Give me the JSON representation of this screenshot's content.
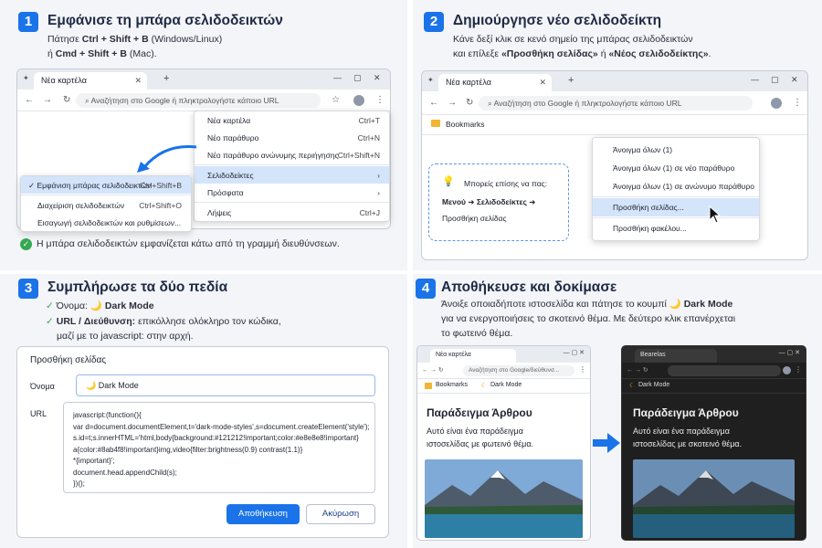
{
  "step1": {
    "num": "1",
    "title": "Εμφάνισε τη μπάρα σελιδοδεικτών",
    "line1_pre": "Πάτησε ",
    "line1_keys": "Ctrl + Shift + B",
    "line1_post": " (Windows/Linux)",
    "line2_pre": "ή ",
    "line2_keys": "Cmd + Shift + B",
    "line2_post": " (Mac).",
    "tab": "Νέα καρτέλα",
    "address": "Αναζήτηση στο Google ή πληκτρολογήστε κάποιο URL",
    "menu": [
      {
        "label": "Νέα καρτέλα",
        "sc": "Ctrl+T"
      },
      {
        "label": "Νέο παράθυρο",
        "sc": "Ctrl+N"
      },
      {
        "label": "Νέο παράθυρο ανώνυμης περιήγησης",
        "sc": "Ctrl+Shift+N"
      },
      {
        "label": "Σελιδοδείκτες",
        "sc": "›"
      },
      {
        "label": "Πρόσφατα",
        "sc": "›"
      },
      {
        "label": "Λήψεις",
        "sc": "Ctrl+J"
      }
    ],
    "submenu": [
      {
        "label": "✓  Εμφάνιση μπάρας σελιδοδεικτών",
        "sc": "Ctrl+Shift+B"
      },
      {
        "label": "Διαχείριση σελιδοδεικτών",
        "sc": "Ctrl+Shift+O"
      },
      {
        "label": "Εισαγωγή σελιδοδεικτών και ρυθμίσεων...",
        "sc": ""
      }
    ],
    "result": "Η μπάρα σελιδοδεικτών εμφανίζεται κάτω από τη γραμμή διευθύνσεων."
  },
  "step2": {
    "num": "2",
    "title": "Δημιούργησε νέο σελιδοδείκτη",
    "line1": "Κάνε δεξί κλικ σε κενό σημείο της μπάρας σελιδοδεικτών",
    "line2_pre": "και επίλεξε ",
    "line2_a": "«Προσθήκη σελίδας»",
    "line2_mid": " ή ",
    "line2_b": "«Νέος σελιδοδείκτης»",
    "line2_post": ".",
    "tab": "Νέα καρτέλα",
    "address": "Αναζήτηση στο Google ή πληκτρολογήστε κάποιο URL",
    "bookmarks": "Bookmarks",
    "tip_title": "Μπορείς επίσης να πας:",
    "tip_path": "Μενού  ➜  Σελιδοδείκτες  ➜",
    "tip_last": "Προσθήκη σελίδας",
    "menu": [
      "Άνοιγμα όλων (1)",
      "Άνοιγμα όλων (1) σε νέο παράθυρο",
      "Άνοιγμα όλων (1) σε ανώνυμο παράθυρο",
      "Προσθήκη σελίδας...",
      "Προσθήκη φακέλου..."
    ]
  },
  "step3": {
    "num": "3",
    "title": "Συμπλήρωσε τα δύο πεδία",
    "b1_label": "Όνομα:",
    "b1_value": "🌙 Dark Mode",
    "b2_label": "URL / Διεύθυνση:",
    "b2_text": " επικόλλησε ολόκληρο τον κώδικα,",
    "b3": "μαζί με το javascript: στην αρχή.",
    "form_title": "Προσθήκη σελίδας",
    "name_label": "Όνομα",
    "name_value": "🌙 Dark Mode",
    "url_label": "URL",
    "code": [
      "javascript:(function(){",
      "var d=document.documentElement,t='dark-mode-styles',s=document.createElement('style');",
      "s.id=t;s.innerHTML='html,body{background:#121212!important;color:#e8e8e8!important}",
      "a{color:#8ab4f8!important}img,video{filter:brightness(0.9) contrast(1.1)}",
      "*{important}';",
      "document.head.appendChild(s);",
      "})();"
    ],
    "save": "Αποθήκευση",
    "cancel": "Ακύρωση"
  },
  "step4": {
    "num": "4",
    "title": "Αποθήκευσε και δοκίμασε",
    "line1_pre": "Άνοιξε οποιαδήποτε ιστοσελίδα και πάτησε το κουμπί ",
    "line1_b": "🌙 Dark Mode",
    "line2": "για να ενεργοποιήσεις το σκοτεινό θέμα. Με δεύτερο κλικ επανέρχεται",
    "line3": "το φωτεινό θέμα.",
    "light_tab": "Νέα καρτέλα",
    "light_addr": "Αναζήτηση στο Google/διεύθυνσ...",
    "dark_tab": "Bearelas",
    "bm1": "Bookmarks",
    "bm2": "Dark Mode",
    "art_title": "Παράδειγμα Άρθρου",
    "light_text1": "Αυτό είναι ένα παράδειγμα",
    "light_text2": "ιστοσελίδας με φωτεινό θέμα.",
    "dark_text1": "Αυτό είναι ένα παράδειγμα",
    "dark_text2": "ιστοσελίδας με σκοτεινό θέμα."
  },
  "colors": {
    "accent": "#1a73e8",
    "panel_bg": "#f3f5f8",
    "dark_bg": "#1f1f1f",
    "success": "#34a853"
  }
}
